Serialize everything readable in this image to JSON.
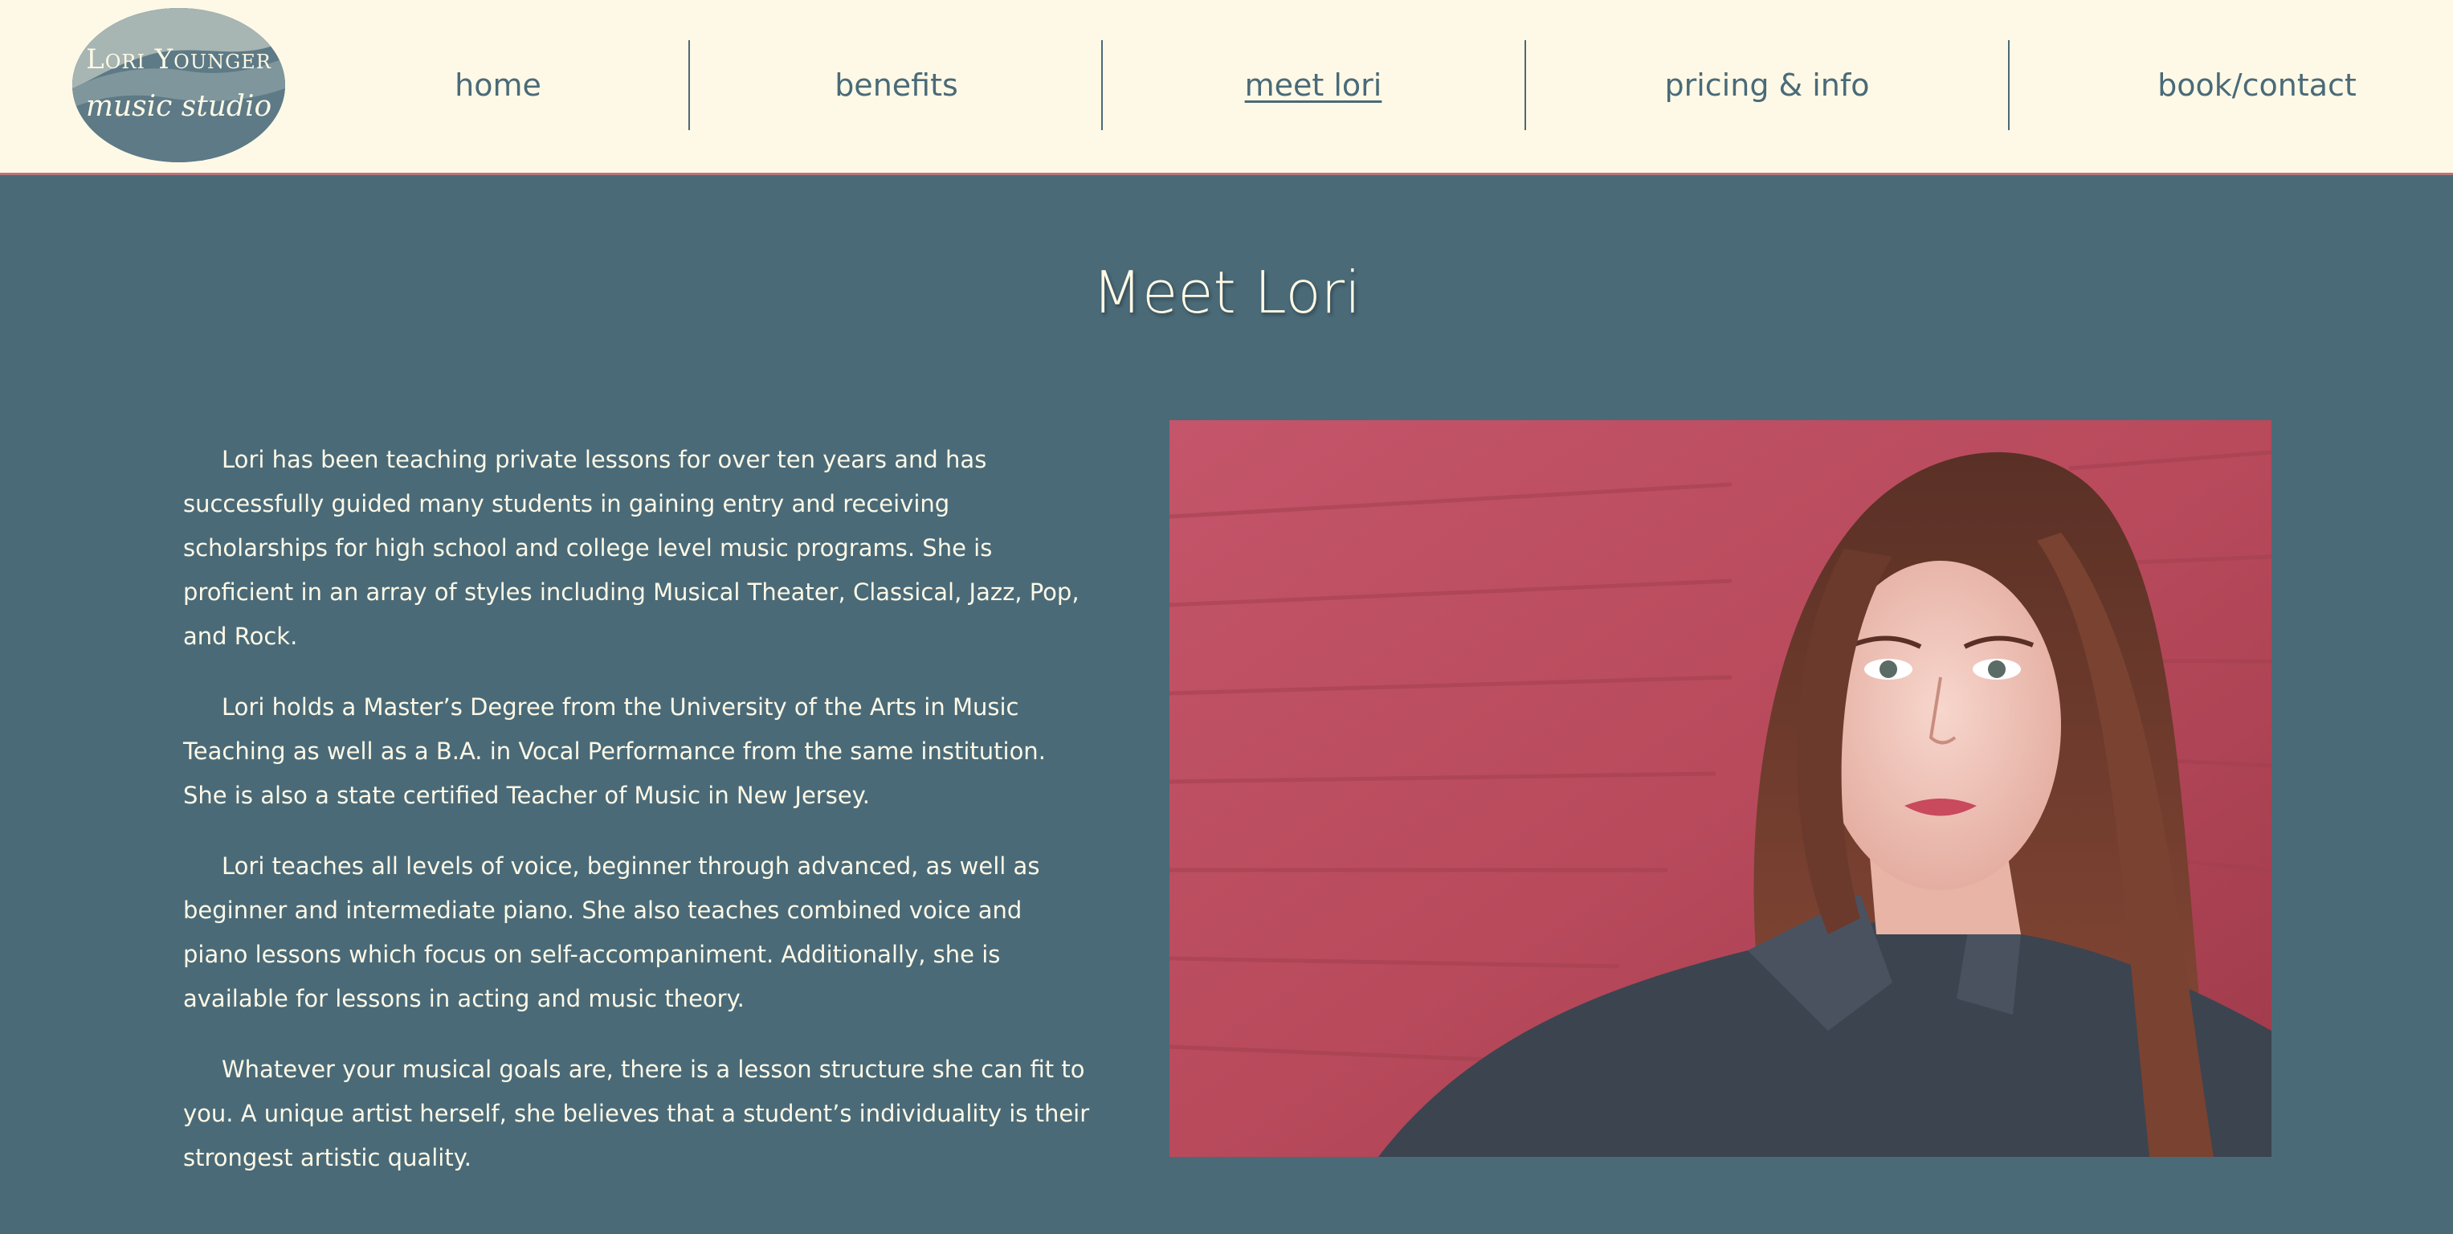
{
  "logo": {
    "line1": "Lori Younger",
    "line2": "music studio"
  },
  "nav": {
    "items": [
      {
        "label": "home"
      },
      {
        "label": "benefits"
      },
      {
        "label": "meet lori"
      },
      {
        "label": "pricing & info"
      },
      {
        "label": "book/contact"
      }
    ],
    "active": "meet lori"
  },
  "page": {
    "title": "Meet Lori",
    "paragraphs": [
      "Lori has been teaching private lessons for over ten years and has successfully guided many students in gaining entry and receiving scholarships for high school and college level music programs. She is proficient in an array of styles including Musical Theater, Classical, Jazz, Pop, and Rock.",
      "Lori holds a Master’s Degree from the University of the Arts in Music Teaching as well as a B.A. in Vocal Performance from the same institution. She is also a state certified Teacher of Music in New Jersey.",
      "Lori teaches all levels of voice, beginner through advanced, as well as beginner and intermediate piano. She also teaches combined voice and piano lessons which focus on self-accompaniment. Additionally, she is available for lessons in acting and music theory.",
      "Whatever your musical goals are, there is a lesson structure she can fit to you. A unique artist herself, she believes that a student’s individuality is their strongest artistic quality."
    ]
  },
  "colors": {
    "header_bg": "#fef9e6",
    "page_bg": "#4a6a78",
    "text_light": "#fef9e6",
    "accent": "#b9747c"
  }
}
